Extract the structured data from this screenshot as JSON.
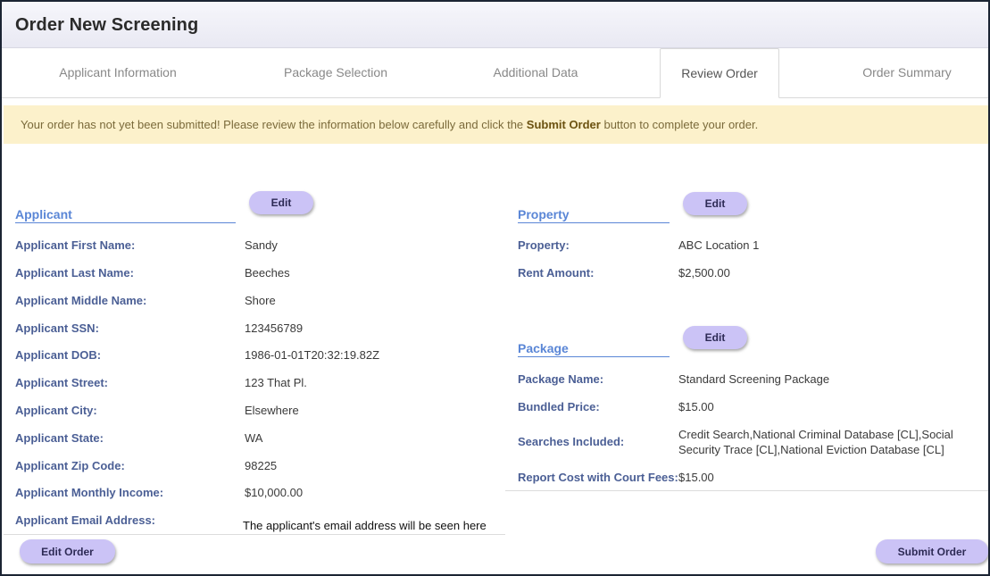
{
  "window": {
    "title": "Order New Screening"
  },
  "tabs": [
    {
      "label": "Applicant Information"
    },
    {
      "label": "Package Selection"
    },
    {
      "label": "Additional Data"
    },
    {
      "label": "Review Order"
    },
    {
      "label": "Order Summary"
    }
  ],
  "active_tab": "Review Order",
  "notice": {
    "before": "Your order has not yet been submitted! Please review the information below carefully and click the ",
    "bold": "Submit Order",
    "after": " button to complete your order."
  },
  "applicant": {
    "title": "Applicant",
    "edit_label": "Edit",
    "fields": [
      {
        "label": "Applicant First Name:",
        "value": "Sandy"
      },
      {
        "label": "Applicant Last Name:",
        "value": "Beeches"
      },
      {
        "label": "Applicant Middle Name:",
        "value": "Shore"
      },
      {
        "label": "Applicant SSN:",
        "value": "123456789"
      },
      {
        "label": "Applicant DOB:",
        "value": "1986-01-01T20:32:19.82Z"
      },
      {
        "label": "Applicant Street:",
        "value": "123 That Pl."
      },
      {
        "label": "Applicant City:",
        "value": "Elsewhere"
      },
      {
        "label": "Applicant State:",
        "value": "WA"
      },
      {
        "label": "Applicant Zip Code:",
        "value": "98225"
      },
      {
        "label": "Applicant Monthly Income:",
        "value": "$10,000.00"
      },
      {
        "label": "Applicant Email Address:",
        "value": "The applicant's email address will be seen here"
      }
    ]
  },
  "property": {
    "title": "Property",
    "edit_label": "Edit",
    "fields": [
      {
        "label": "Property:",
        "value": "ABC Location 1"
      },
      {
        "label": "Rent Amount:",
        "value": "$2,500.00"
      }
    ]
  },
  "package": {
    "title": "Package",
    "edit_label": "Edit",
    "fields": [
      {
        "label": "Package Name:",
        "value": "Standard Screening Package"
      },
      {
        "label": "Bundled Price:",
        "value": "$15.00"
      },
      {
        "label": "Searches Included:",
        "value_line1": "Credit Search,National Criminal Database [CL],Social",
        "value_line2": "Security Trace [CL],National Eviction Database [CL]"
      },
      {
        "label": "Report Cost with Court Fees:",
        "value": "$15.00"
      }
    ]
  },
  "footer": {
    "edit_order_label": "Edit Order",
    "submit_order_label": "Submit Order"
  }
}
